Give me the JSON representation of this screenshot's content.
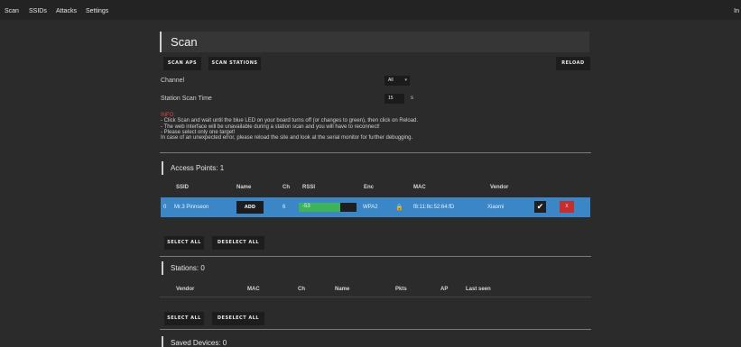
{
  "nav": {
    "scan": "Scan",
    "ssids": "SSIDs",
    "attacks": "Attacks",
    "settings": "Settings",
    "info": "In"
  },
  "header": {
    "title": "Scan"
  },
  "toolbar": {
    "scan_aps": "SCAN APS",
    "scan_stations": "SCAN STATIONS",
    "reload": "RELOAD"
  },
  "settings": {
    "channel_label": "Channel",
    "channel_value": "All",
    "scan_time_label": "Station Scan Time",
    "scan_time_value": "15",
    "scan_time_unit": "s"
  },
  "info": {
    "heading": "INFO:",
    "lines": [
      "- Click Scan and wait until the blue LED on your board turns off (or changes to green), then click on Reload.",
      "- The web interface will be unavailable during a station scan and you will have to reconnect!",
      "- Please select only one target!",
      "In case of an unexpected error, please reload the site and look at the serial monitor for further debugging."
    ]
  },
  "access_points": {
    "title": "Access Points: 1",
    "columns": {
      "ssid": "SSID",
      "name": "Name",
      "ch": "Ch",
      "rssi": "RSSI",
      "enc": "Enc",
      "mac": "MAC",
      "vendor": "Vendor"
    },
    "rows": [
      {
        "index": "0",
        "ssid": "Mr.3 Pinnseon",
        "add": "ADD",
        "ch": "6",
        "rssi": "-53",
        "rssi_level": 0.72,
        "enc": "WPA2",
        "mac": "f8:11:8c:52:64:fD",
        "vendor": "Xiaomi",
        "selected": true,
        "remove": "X"
      }
    ],
    "select_all": "SELECT ALL",
    "deselect_all": "DESELECT ALL"
  },
  "stations": {
    "title": "Stations: 0",
    "columns": {
      "vendor": "Vendor",
      "mac": "MAC",
      "ch": "Ch",
      "name": "Name",
      "pkts": "Pkts",
      "ap": "AP",
      "last_seen": "Last seen"
    },
    "select_all": "SELECT ALL",
    "deselect_all": "DESELECT ALL"
  },
  "saved_devices": {
    "title": "Saved Devices: 0"
  },
  "colors": {
    "accent": "#3b86c6",
    "rssi_green": "#3db457",
    "danger": "#c62e2e",
    "info_red": "#e04646"
  }
}
